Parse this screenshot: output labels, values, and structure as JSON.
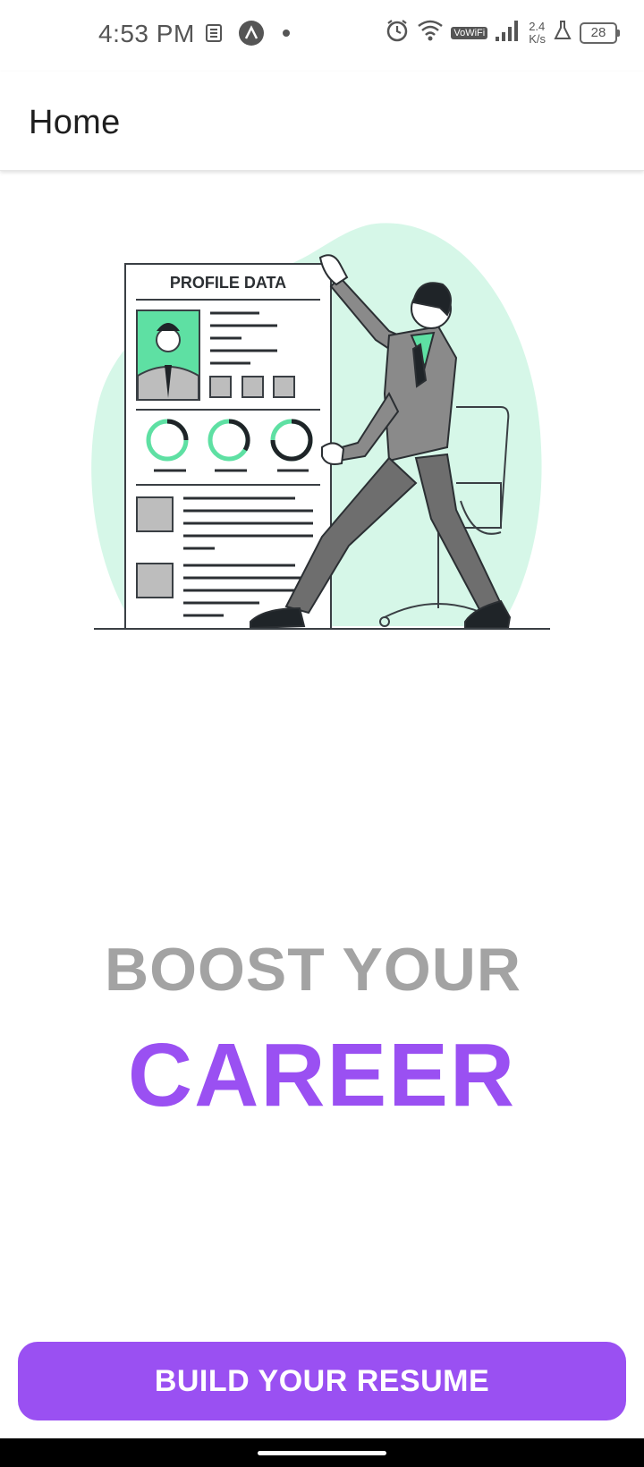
{
  "status_bar": {
    "time": "4:53 PM",
    "net_speed_value": "2.4",
    "net_speed_unit": "K/s",
    "wifi_tag": "VoWiFi",
    "battery": "28",
    "icons": [
      "news-icon",
      "arch-app-icon",
      "dot-icon",
      "alarm-icon",
      "wifi-icon",
      "signal-icon",
      "flask-icon",
      "battery-icon"
    ]
  },
  "app_bar": {
    "title": "Home"
  },
  "illustration": {
    "card_title": "PROFILE DATA",
    "accent": "#5ee0a3",
    "blob": "#d6f7e8"
  },
  "hero": {
    "line1": "BOOST YOUR",
    "line2": "CAREER"
  },
  "cta": {
    "label": "BUILD YOUR RESUME"
  },
  "colors": {
    "primary": "#9a50f2",
    "headline_gray": "#a3a3a3"
  }
}
